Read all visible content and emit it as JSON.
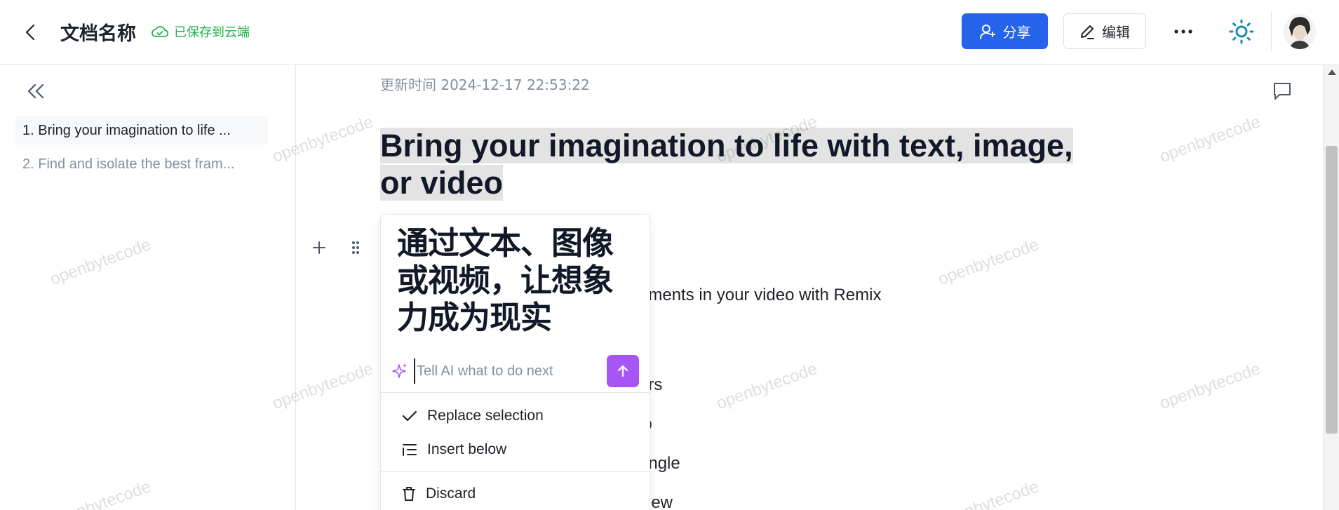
{
  "header": {
    "doc_title": "文档名称",
    "save_status": "已保存到云端",
    "share_label": "分享",
    "edit_label": "编辑"
  },
  "sidebar": {
    "toc": [
      {
        "label": "1. Bring your imagination to life ..."
      },
      {
        "label": "2. Find and isolate the best fram..."
      }
    ]
  },
  "main": {
    "update_time": "更新时间 2024-12-17 22:53:22",
    "heading_line1": "Bring your imagination to life with text, image,",
    "heading_line2": "or video",
    "body_lines": [
      "ements in your video with Remix",
      "ors",
      "ip",
      "ungle",
      "view"
    ]
  },
  "ai_popup": {
    "result_text": "通过文本、图像或视频，让想象力成为现实",
    "input_placeholder": "Tell AI what to do next",
    "options": [
      {
        "label": "Replace selection"
      },
      {
        "label": "Insert below"
      },
      {
        "label": "Discard"
      }
    ]
  },
  "watermark": "openbytecode",
  "colors": {
    "primary": "#2563eb",
    "saved": "#22b14c",
    "ai_accent": "#a855f7",
    "theme_icon": "#1a8ab0"
  }
}
